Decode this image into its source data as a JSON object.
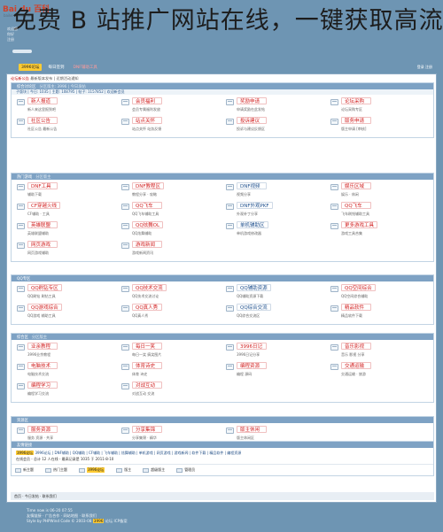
{
  "title": "免费 B 站推广网站在线，一键获取高流量",
  "watermark": "Bai du 百科",
  "watermark_sub": "baike.baidu.com",
  "left_text": [
    "欢迎您",
    "你好",
    "注册"
  ],
  "site_logo": "logo",
  "nav": {
    "items": [
      "3996论坛",
      "每日签到",
      "DNF辅助工具"
    ],
    "right": "登录 注册"
  },
  "announce": {
    "prefix": "论坛新公告",
    "text": "最新版本发布 | 近期活动通知"
  },
  "sections": [
    {
      "header": "综合讨论区",
      "muted": "分区版主: 3996 | 今日发帖",
      "sub": "子版块 | 今日: 1035 | 主题: 108795 | 帖子: 1157852 | 欢迎新会员",
      "forums": [
        {
          "name": "新人报道",
          "desc": "新人来这里报到吧"
        },
        {
          "name": "会员福利",
          "desc": "会员专属福利发放"
        },
        {
          "name": "奖励申请",
          "desc": "申请奖励在此发帖"
        },
        {
          "name": "论坛采购",
          "desc": "论坛采购专区"
        },
        {
          "name": "社区公告",
          "desc": "社区公告 最新公告"
        },
        {
          "name": "站点关怀",
          "desc": "站点关怀 站务反馈"
        },
        {
          "name": "投诉建议",
          "desc": "投诉与建议反馈区"
        },
        {
          "name": "版务申请",
          "desc": "版主申请 [审核]"
        }
      ]
    },
    {
      "header": "热门游戏",
      "muted": "分区版主",
      "sub": "",
      "forums": [
        {
          "name": "DNF工具",
          "desc": "辅助下载"
        },
        {
          "name": "DNF教程区",
          "desc": "教程分享 · 攻略"
        },
        {
          "name": "DNF视频",
          "desc": "视频分享"
        },
        {
          "name": "娱乐区域",
          "desc": "娱乐 · 休闲"
        },
        {
          "name": "CF穿越火线",
          "desc": "CF辅助 · 工具"
        },
        {
          "name": "QQ飞车",
          "desc": "QQ飞车辅助工具"
        },
        {
          "name": "DNF外观PKF",
          "desc": "外观补丁分享"
        },
        {
          "name": "QQ飞车",
          "desc": "飞车刷钱辅助工具"
        },
        {
          "name": "英雄联盟",
          "desc": "英雄联盟辅助"
        },
        {
          "name": "QQ炫舞OL",
          "desc": "QQ炫舞辅助"
        },
        {
          "name": "单机辅助区",
          "desc": "单机游戏修改器"
        },
        {
          "name": "更多游戏工具",
          "desc": "游戏工具合集"
        },
        {
          "name": "网页游戏",
          "desc": "网页游戏辅助"
        },
        {
          "name": "游戏新闻",
          "desc": "游戏新闻资讯"
        }
      ]
    },
    {
      "header": "QQ专区",
      "muted": "",
      "sub": "",
      "forums": [
        {
          "name": "QQ刷钻专区",
          "desc": "QQ刷钻 刷钻工具"
        },
        {
          "name": "QQ技术交流",
          "desc": "QQ技术交流讨论"
        },
        {
          "name": "QQ辅助资源",
          "desc": "QQ辅助资源下载"
        },
        {
          "name": "QQ空间综合",
          "desc": "QQ空间综合辅助"
        },
        {
          "name": "QQ游戏综合",
          "desc": "QQ游戏 辅助工具"
        },
        {
          "name": "QQ真人秀",
          "desc": "QQ真人秀"
        },
        {
          "name": "QQ综合交流",
          "desc": "QQ综合交流区"
        },
        {
          "name": "精品软件",
          "desc": "精品软件下载"
        }
      ]
    },
    {
      "header": "综合区",
      "muted": "分区版主",
      "sub": "",
      "forums": [
        {
          "name": "业余教程",
          "desc": "3996业余教程"
        },
        {
          "name": "每日一笑",
          "desc": "每日一笑 搞笑图片"
        },
        {
          "name": "3996日记",
          "desc": "3996日记分享"
        },
        {
          "name": "音乐影视",
          "desc": "音乐 影视 分享"
        },
        {
          "name": "电脑技术",
          "desc": "电脑技术交流"
        },
        {
          "name": "体育诗史",
          "desc": "体育 诗史"
        },
        {
          "name": "编程资源",
          "desc": "编程 源码"
        },
        {
          "name": "交通运输",
          "desc": "交通运输 · 旅游"
        },
        {
          "name": "编程学习",
          "desc": "编程学习交流"
        },
        {
          "name": "对战互动",
          "desc": "对战互动 交流"
        }
      ]
    },
    {
      "header": "资源区",
      "muted": "",
      "sub": "",
      "forums": [
        {
          "name": "服务资源",
          "desc": "服务 资源 · 共享"
        },
        {
          "name": "分享集锦",
          "desc": "分享集锦 · 精华"
        },
        {
          "name": "版主休闲",
          "desc": "版主休闲区"
        }
      ]
    }
  ],
  "stats": {
    "header": "友情链接",
    "line1_hl": "3996论坛",
    "line1": "3996论坛 | DNF辅助 | QQ辅助 | CF辅助 | 飞车辅助 | 炫舞辅助 | 单机游戏 | 网页游戏 | 游戏新闻 | 软件下载 | 精品软件 | 编程资源",
    "line2": "在线会员 - 总计 12 人在线 - 最高记录是 1035 于 2011-8-10",
    "legend": [
      "新主题",
      "热门主题",
      "3996论坛",
      "版主",
      "超级版主",
      "管理员"
    ]
  },
  "foot_nav": "首页 · 今日发帖 · 联系我们",
  "footer": {
    "line1": "Time now is 06-20 07:55",
    "line2": "友情链接 · 广告合作 · 网站地图 · 联系我们",
    "line3_pre": "Style by PHPWind Code © 2003-08",
    "hl": "3996",
    "line3_post": "论坛 ICP备案"
  },
  "colors": {
    "background": "#6e95b3",
    "header": "#7ea2c4",
    "forum_red": "#d21f1f",
    "highlight": "#ffcc33"
  }
}
